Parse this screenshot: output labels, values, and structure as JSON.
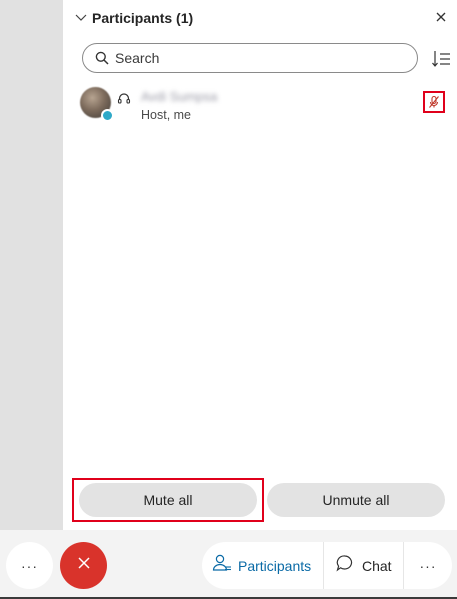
{
  "panel": {
    "title": "Participants (1)",
    "icons": {
      "collapse": "chevron-down-icon",
      "close": "close-icon",
      "sort": "sort-icon"
    }
  },
  "search": {
    "placeholder": "Search",
    "value": "",
    "icon": "search-icon"
  },
  "participants": [
    {
      "name": "Avdi Sumpsa",
      "role": "Host, me",
      "status_icon": "headset-icon",
      "mic_icon": "microphone-muted-icon",
      "presence_color": "#2ea9c8"
    }
  ],
  "actions": {
    "mute_all_label": "Mute all",
    "unmute_all_label": "Unmute all"
  },
  "bottom_bar": {
    "more_label": "···",
    "participants_label": "Participants",
    "chat_label": "Chat",
    "more_right_label": "···",
    "end_call_icon": "close-icon"
  },
  "colors": {
    "accent": "#0a6aa6",
    "end_call": "#d9332b",
    "highlight": "#e0001b",
    "presence": "#2ea9c8"
  }
}
